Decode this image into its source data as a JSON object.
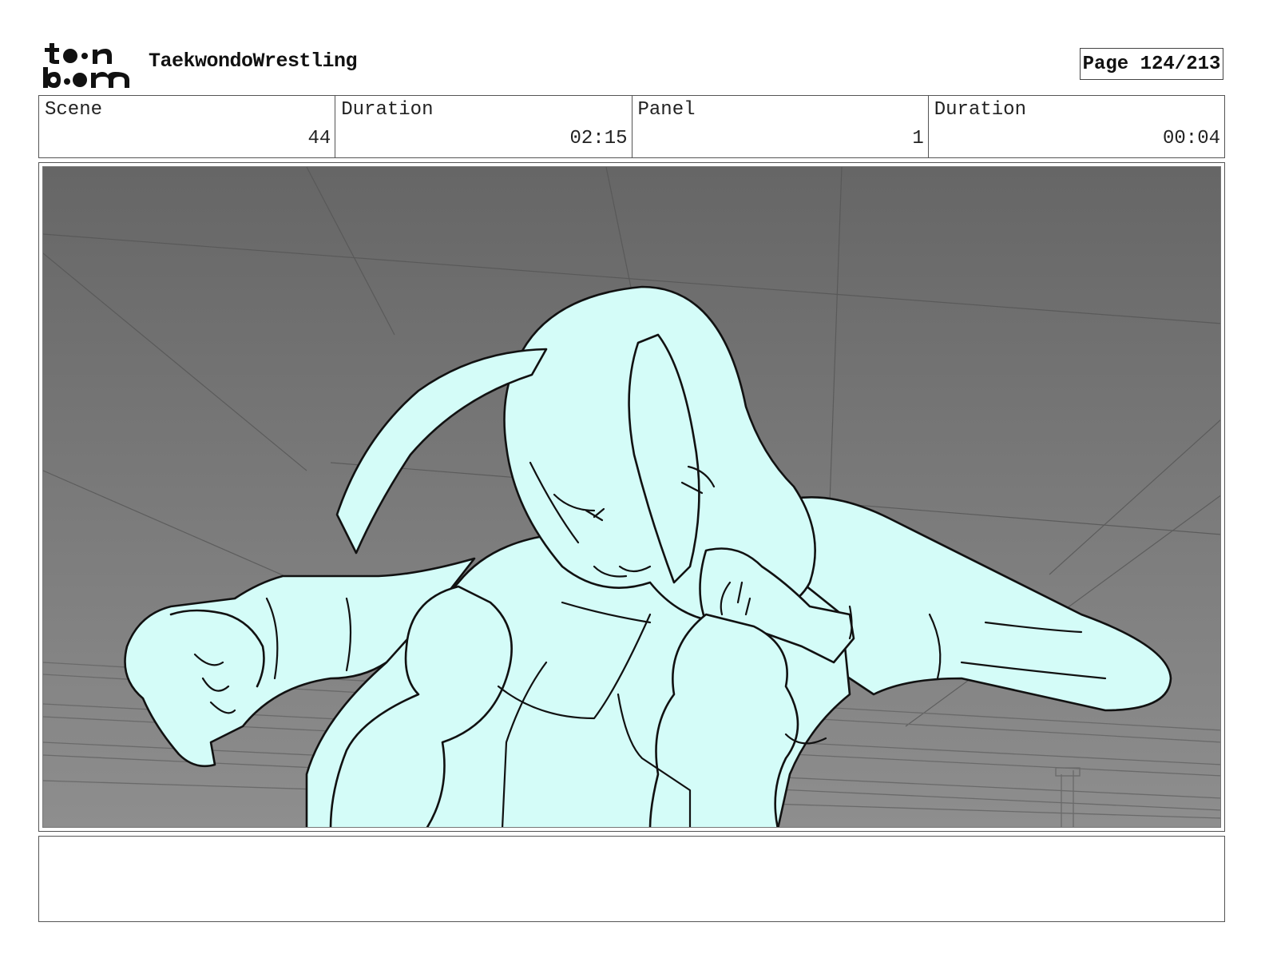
{
  "header": {
    "logo_alt": "toon boom",
    "project_title": "TaekwondoWrestling",
    "page_label": "Page 124/213"
  },
  "info": {
    "scene_label": "Scene",
    "scene_value": "44",
    "scene_duration_label": "Duration",
    "scene_duration_value": "02:15",
    "panel_label": "Panel",
    "panel_value": "1",
    "panel_duration_label": "Duration",
    "panel_duration_value": "00:04"
  },
  "panel_image": {
    "description_icon": "storyboard-drawing",
    "fill_color": "#d4fcf8",
    "background_top": "#666666",
    "background_bottom": "#8e8e8e"
  },
  "notes": {
    "text": ""
  }
}
